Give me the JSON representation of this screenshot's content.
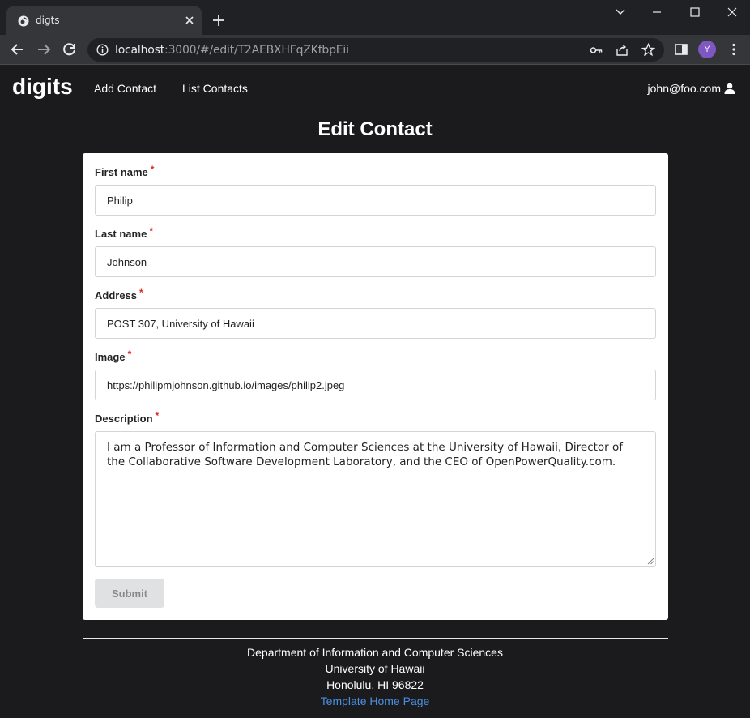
{
  "browser": {
    "tab_title": "digts",
    "url_host": "localhost",
    "url_rest": ":3000/#/edit/T2AEBXHFqZKfbpEii",
    "profile_initial": "Y"
  },
  "navbar": {
    "brand": "digits",
    "links": [
      "Add Contact",
      "List Contacts"
    ],
    "user": "john@foo.com"
  },
  "page": {
    "title": "Edit Contact"
  },
  "form": {
    "first_name": {
      "label": "First name",
      "value": "Philip"
    },
    "last_name": {
      "label": "Last name",
      "value": "Johnson"
    },
    "address": {
      "label": "Address",
      "value": "POST 307, University of Hawaii"
    },
    "image": {
      "label": "Image",
      "value": "https://philipmjohnson.github.io/images/philip2.jpeg"
    },
    "description": {
      "label": "Description",
      "value": "I am a Professor of Information and Computer Sciences at the University of Hawaii, Director of the Collaborative Software Development Laboratory, and the CEO of OpenPowerQuality.com."
    },
    "required_marker": "*",
    "submit_label": "Submit"
  },
  "footer": {
    "line1": "Department of Information and Computer Sciences",
    "line2": "University of Hawaii",
    "line3": "Honolulu, HI 96822",
    "link": "Template Home Page"
  },
  "colors": {
    "required": "#db2828",
    "link": "#4a90e2",
    "background": "#1b1b1d"
  }
}
